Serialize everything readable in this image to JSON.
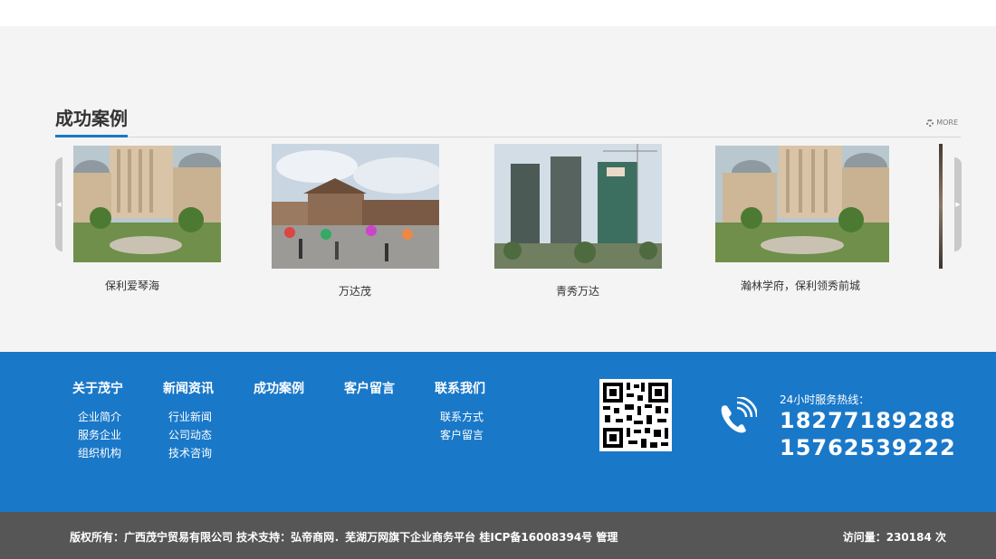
{
  "cases": {
    "title": "成功案例",
    "more_label": "MORE",
    "items": [
      {
        "caption": "保利爱琴海"
      },
      {
        "caption": "万达茂"
      },
      {
        "caption": "青秀万达"
      },
      {
        "caption": "瀚林学府，保利领秀前城"
      }
    ]
  },
  "footer": {
    "nav": [
      {
        "heading": "关于茂宁",
        "links": [
          "企业简介",
          "服务企业",
          "组织机构"
        ]
      },
      {
        "heading": "新闻资讯",
        "links": [
          "行业新闻",
          "公司动态",
          "技术咨询"
        ]
      },
      {
        "heading": "成功案例",
        "links": []
      },
      {
        "heading": "客户留言",
        "links": []
      },
      {
        "heading": "联系我们",
        "links": [
          "联系方式",
          "客户留言"
        ]
      }
    ],
    "hotline_label": "24小时服务热线：",
    "phones": [
      "18277189288",
      "15762539222"
    ]
  },
  "bottom": {
    "copyright": "版权所有：广西茂宁贸易有限公司 技术支持：弘帝商网．芜湖万网旗下企业商务平台 桂ICP备16008394号 管理",
    "visits": "访问量：230184 次"
  },
  "colors": {
    "accent": "#1a78c8",
    "footer_bottom": "#565656",
    "section_bg": "#f4f4f4"
  }
}
